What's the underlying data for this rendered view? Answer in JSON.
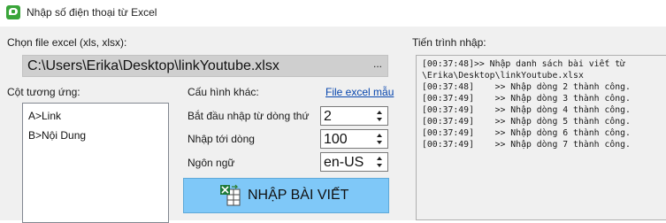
{
  "window": {
    "title": "Nhập số điện thoại từ Excel",
    "icon": "app-chat-icon"
  },
  "file_section": {
    "label": "Chọn file excel (xls, xlsx):",
    "path_value": "C:\\Users\\Erika\\Desktop\\linkYoutube.xlsx",
    "browse_label": "..."
  },
  "mapping": {
    "label": "Cột tương ứng:",
    "items": [
      "A>Link",
      "B>Nội Dung"
    ]
  },
  "config": {
    "label": "Cấu hình khác:",
    "sample_link": "File excel mẫu",
    "start_row_label": "Bắt đầu nhập từ dòng thứ",
    "start_row_value": "2",
    "end_row_label": "Nhập tới dòng",
    "end_row_value": "100",
    "language_label": "Ngôn ngữ",
    "language_value": "en-US"
  },
  "import_button": {
    "label": "NHẬP BÀI VIẾT",
    "icon": "excel-import-icon"
  },
  "progress": {
    "label": "Tiến trình nhập:",
    "lines": [
      "[00:37:48]>> Nhập danh sách bài viết từ",
      "\\Erika\\Desktop\\linkYoutube.xlsx",
      "[00:37:48]    >> Nhập dòng 2 thành công.",
      "[00:37:49]    >> Nhập dòng 3 thành công.",
      "[00:37:49]    >> Nhập dòng 4 thành công.",
      "[00:37:49]    >> Nhập dòng 5 thành công.",
      "[00:37:49]    >> Nhập dòng 6 thành công.",
      "[00:37:49]    >> Nhập dòng 7 thành công."
    ]
  }
}
